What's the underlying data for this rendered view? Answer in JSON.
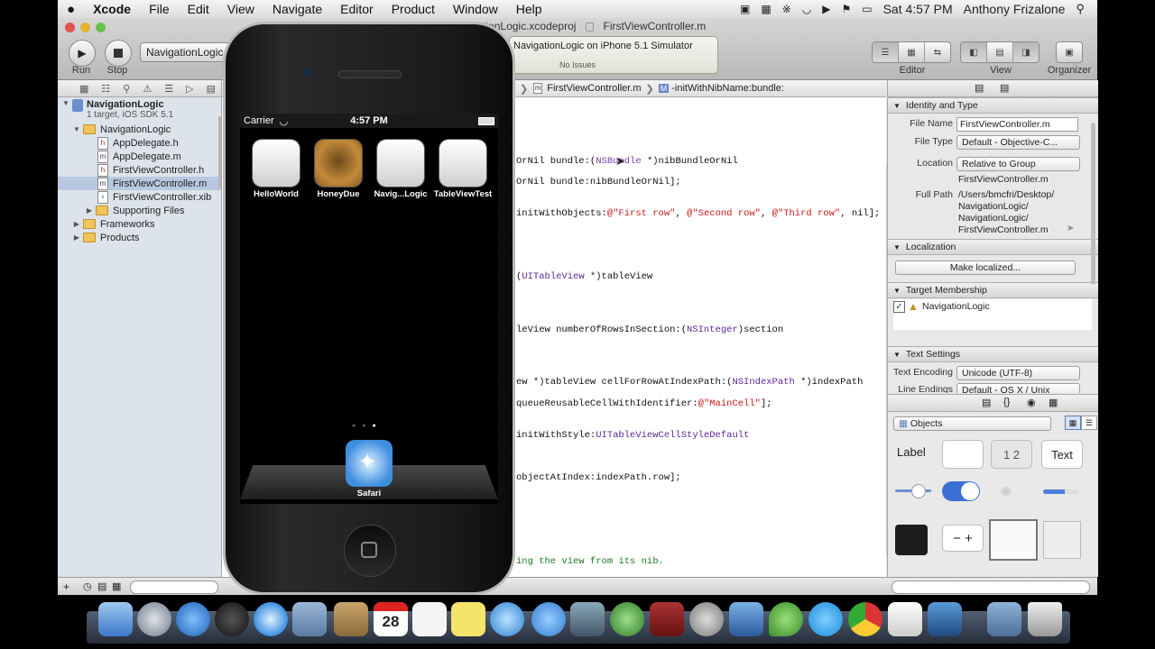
{
  "menubar": {
    "apple": "",
    "app": "Xcode",
    "items": [
      "File",
      "Edit",
      "View",
      "Navigate",
      "Editor",
      "Product",
      "Window",
      "Help"
    ],
    "clock": "Sat 4:57 PM",
    "user": "Anthony Frizalone"
  },
  "window": {
    "title": "NavigationLogic.xcodeproj",
    "title_file": "FirstViewController.m"
  },
  "toolbar": {
    "run_label": "Run",
    "stop_label": "Stop",
    "scheme": "NavigationLogic",
    "activity_title": "NavigationLogic on iPhone 5.1 Simulator",
    "activity_status": "No Issues",
    "editor_label": "Editor",
    "view_label": "View",
    "organizer_label": "Organizer"
  },
  "navigator": {
    "project": "NavigationLogic",
    "project_sub": "1 target, iOS SDK 5.1",
    "group": "NavigationLogic",
    "files": [
      {
        "name": "AppDelegate.h",
        "type": "h"
      },
      {
        "name": "AppDelegate.m",
        "type": "m"
      },
      {
        "name": "FirstViewController.h",
        "type": "h"
      },
      {
        "name": "FirstViewController.m",
        "type": "m"
      },
      {
        "name": "FirstViewController.xib",
        "type": "xib"
      }
    ],
    "supporting": "Supporting Files",
    "frameworks": "Frameworks",
    "products": "Products"
  },
  "jumpbar": {
    "file": "FirstViewController.m",
    "method": "-initWithNibName:bundle:"
  },
  "code": {
    "l1a": "OrNil bundle:(",
    "l1b": "NSBundle",
    "l1c": " *)nibBundleOrNil",
    "l2": "OrNil bundle:nibBundleOrNil];",
    "l3a": "initWithObjects:",
    "l3b": "@\"First row\"",
    "l3c": ", ",
    "l3d": "@\"Second row\"",
    "l3e": ", ",
    "l3f": "@\"Third row\"",
    "l3g": ", nil];",
    "l4a": "(",
    "l4b": "UITableView",
    "l4c": " *)tableView",
    "l5a": "leView numberOfRowsInSection:(",
    "l5b": "NSInteger",
    "l5c": ")section",
    "l6a": "ew *)tableView cellForRowAtIndexPath:(",
    "l6b": "NSIndexPath",
    "l6c": " *)indexPath",
    "l7a": "queueReusableCellWithIdentifier:",
    "l7b": "@\"MainCell\"",
    "l7c": "];",
    "l8a": "initWithStyle:",
    "l8b": "UITableViewCellStyleDefault",
    "l9": "objectAtIndex:indexPath.row];",
    "l10": "ing the view from its nib."
  },
  "inspector": {
    "identity_header": "Identity and Type",
    "file_name_label": "File Name",
    "file_name": "FirstViewController.m",
    "file_type_label": "File Type",
    "file_type": "Default - Objective-C...",
    "location_label": "Location",
    "location": "Relative to Group",
    "location_file": "FirstViewController.m",
    "full_path_label": "Full Path",
    "full_path_1": "/Users/bmcfri/Desktop/",
    "full_path_2": "NavigationLogic/",
    "full_path_3": "NavigationLogic/",
    "full_path_4": "FirstViewController.m",
    "localization_header": "Localization",
    "make_localized": "Make localized...",
    "target_header": "Target Membership",
    "target": "NavigationLogic",
    "text_settings_header": "Text Settings",
    "text_encoding_label": "Text Encoding",
    "text_encoding": "Unicode (UTF-8)",
    "line_endings_label": "Line Endings",
    "line_endings": "Default - OS X / Unix",
    "objects_popup": "Objects",
    "lib_label": "Label",
    "lib_text": "Text",
    "lib_seg": "1 2"
  },
  "simulator": {
    "carrier": "Carrier",
    "time": "4:57 PM",
    "apps": [
      "HelloWorld",
      "HoneyDue",
      "Navig...Logic",
      "TableViewTest"
    ],
    "dock_app": "Safari"
  },
  "dock": {
    "calendar_day": "28"
  }
}
